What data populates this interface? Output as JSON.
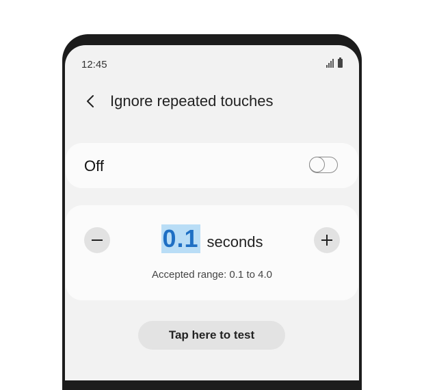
{
  "status_bar": {
    "time": "12:45",
    "icons": [
      "signal-icon",
      "battery-icon"
    ]
  },
  "header": {
    "title": "Ignore repeated touches",
    "back_icon": "chevron-left-icon"
  },
  "toggle_card": {
    "label": "Off",
    "state": "off"
  },
  "time_card": {
    "value": "0.1",
    "unit": "seconds",
    "range_text": "Accepted range: 0.1 to 4.0",
    "minus_icon": "minus-icon",
    "plus_icon": "plus-icon"
  },
  "test_button": {
    "label": "Tap here to test"
  },
  "colors": {
    "accent": "#1e6fc4",
    "highlight": "#b9ddf6",
    "screen_bg": "#f2f2f2",
    "card_bg": "#fbfbfb"
  }
}
